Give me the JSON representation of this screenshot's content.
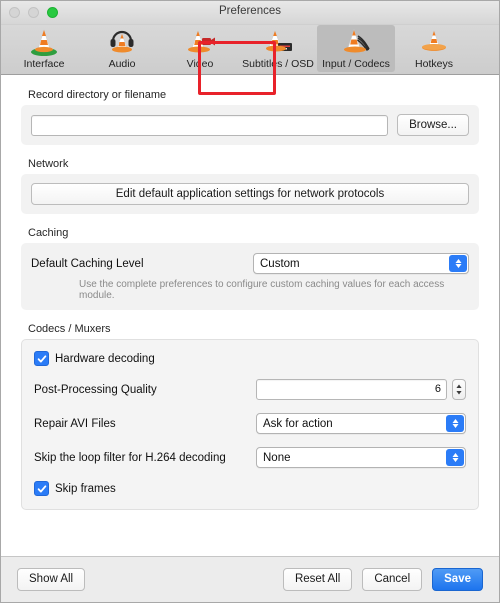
{
  "window": {
    "title": "Preferences",
    "traffic_lights": [
      {
        "name": "close",
        "state": "disabled"
      },
      {
        "name": "minimize",
        "state": "disabled"
      },
      {
        "name": "zoom",
        "state": "active"
      }
    ]
  },
  "toolbar": {
    "tabs": [
      {
        "label": "Interface",
        "icon": "vlc-cone-interface-icon",
        "selected": false
      },
      {
        "label": "Audio",
        "icon": "vlc-cone-audio-icon",
        "selected": false
      },
      {
        "label": "Video",
        "icon": "vlc-cone-video-icon",
        "selected": false
      },
      {
        "label": "Subtitles / OSD",
        "icon": "vlc-cone-subtitles-icon",
        "selected": false
      },
      {
        "label": "Input / Codecs",
        "icon": "vlc-cone-input-codecs-icon",
        "selected": true
      },
      {
        "label": "Hotkeys",
        "icon": "vlc-cone-hotkeys-icon",
        "selected": false
      }
    ],
    "highlight_color": "#e8222a"
  },
  "record": {
    "group_label": "Record directory or filename",
    "path_value": "",
    "path_placeholder": "",
    "browse_label": "Browse..."
  },
  "network": {
    "group_label": "Network",
    "edit_defaults_label": "Edit default application settings for network protocols"
  },
  "caching": {
    "group_label": "Caching",
    "level_label": "Default Caching Level",
    "level_value": "Custom",
    "hint": "Use the complete preferences to configure custom caching values for each access module."
  },
  "codecs": {
    "group_label": "Codecs / Muxers",
    "hardware_decoding_label": "Hardware decoding",
    "hardware_decoding_checked": true,
    "post_processing_label": "Post-Processing Quality",
    "post_processing_value": "6",
    "repair_avi_label": "Repair AVI Files",
    "repair_avi_value": "Ask for action",
    "loop_filter_label": "Skip the loop filter for H.264 decoding",
    "loop_filter_value": "None",
    "skip_frames_label": "Skip frames",
    "skip_frames_checked": true
  },
  "footer": {
    "show_all_label": "Show All",
    "reset_all_label": "Reset All",
    "cancel_label": "Cancel",
    "save_label": "Save",
    "accent_color": "#2b7cf7"
  }
}
